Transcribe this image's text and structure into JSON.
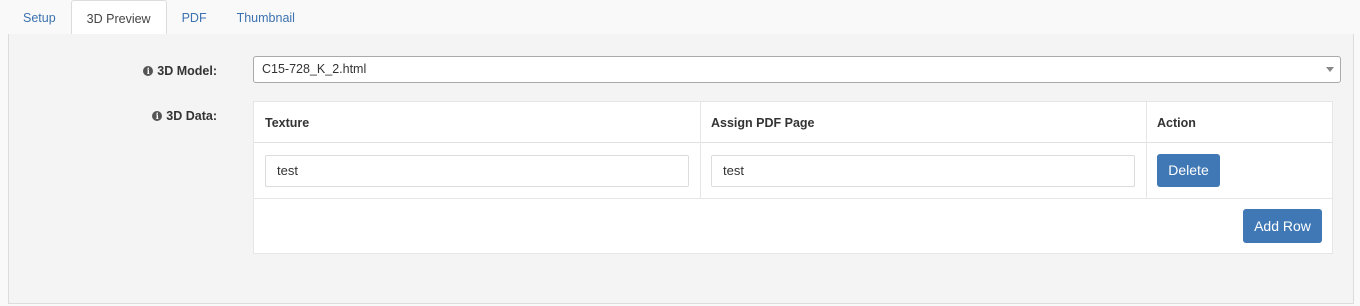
{
  "tabs": [
    {
      "label": "Setup",
      "active": false
    },
    {
      "label": "3D Preview",
      "active": true
    },
    {
      "label": "PDF",
      "active": false
    },
    {
      "label": "Thumbnail",
      "active": false
    }
  ],
  "form": {
    "model_label": "3D Model:",
    "model_value": "C15-728_K_2.html",
    "data_label": "3D Data:"
  },
  "table": {
    "headers": [
      "Texture",
      "Assign PDF Page",
      "Action"
    ],
    "rows": [
      {
        "texture": "test",
        "pdf_page": "test",
        "action_label": "Delete"
      }
    ],
    "add_row_label": "Add Row"
  },
  "colors": {
    "accent": "#3f78b4",
    "link": "#3d72b0"
  }
}
